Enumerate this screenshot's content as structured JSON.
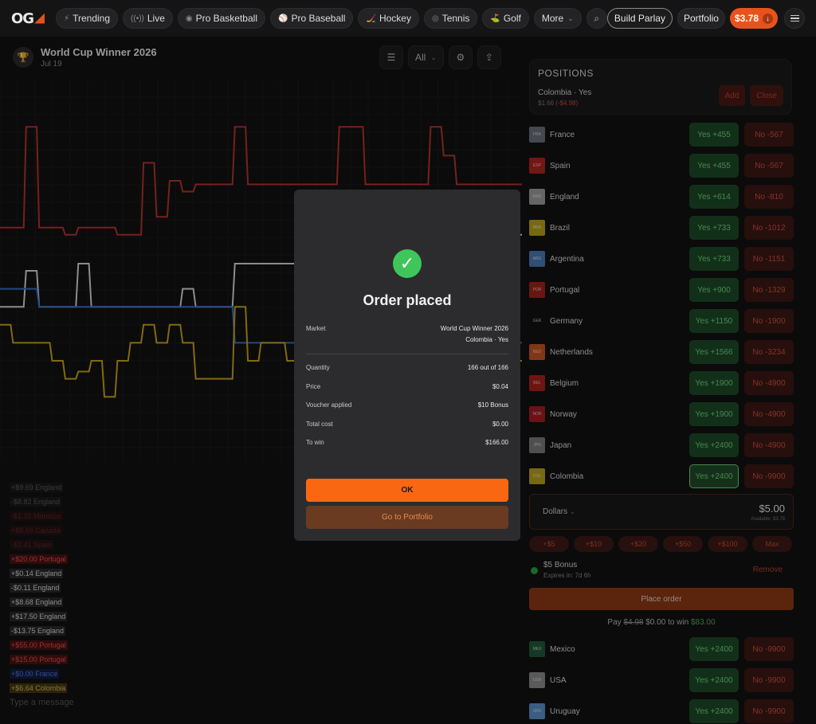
{
  "nav": {
    "logo_text": "OG",
    "tabs": [
      {
        "icon": "⚡",
        "label": "Trending"
      },
      {
        "icon": "((•))",
        "label": "Live"
      },
      {
        "icon": "◉",
        "label": "Pro Basketball"
      },
      {
        "icon": "⚾",
        "label": "Pro Baseball"
      },
      {
        "icon": "🏒",
        "label": "Hockey"
      },
      {
        "icon": "◎",
        "label": "Tennis"
      },
      {
        "icon": "⛳",
        "label": "Golf"
      },
      {
        "icon": "",
        "label": "More"
      }
    ],
    "build_parlay": "Build Parlay",
    "portfolio": "Portfolio",
    "balance": "$3.78"
  },
  "market": {
    "title": "World Cup Winner 2026",
    "date": "Jul 19",
    "filter_all": "All"
  },
  "chat": {
    "messages": [
      {
        "text": "+$9.69 England",
        "style": "dim"
      },
      {
        "text": "-$8.82 England",
        "style": "dim"
      },
      {
        "text": "-$1.32 Morocco",
        "style": "dim red"
      },
      {
        "text": "+$8.66 Canada",
        "style": "dim red"
      },
      {
        "text": "-$2.41 Spain",
        "style": "dim red"
      },
      {
        "text": "+$20.00 Portugal",
        "style": "red"
      },
      {
        "text": "+$0.14 England",
        "style": ""
      },
      {
        "text": "-$0.11 England",
        "style": ""
      },
      {
        "text": "+$8.68 England",
        "style": ""
      },
      {
        "text": "+$17.50 England",
        "style": ""
      },
      {
        "text": "-$13.75 England",
        "style": ""
      },
      {
        "text": "+$55.00 Portugal",
        "style": "red"
      },
      {
        "text": "+$15.00 Portugal",
        "style": "red"
      },
      {
        "text": "+$0.00 France",
        "style": "blue"
      },
      {
        "text": "+$6.64 Colombia",
        "style": "gold"
      }
    ],
    "placeholder": "Type a message"
  },
  "positions": {
    "title": "POSITIONS",
    "name": "Colombia · Yes",
    "value": "$1.66",
    "change": "(-$4.98)",
    "add": "Add",
    "close": "Close"
  },
  "teams": [
    {
      "code": "FRA",
      "name": "France",
      "yes": "Yes +455",
      "no": "No -567",
      "flag": "#6a6f7a"
    },
    {
      "code": "ESP",
      "name": "Spain",
      "yes": "Yes +455",
      "no": "No -567",
      "flag": "#b1241f"
    },
    {
      "code": "ENG",
      "name": "England",
      "yes": "Yes +614",
      "no": "No -810",
      "flag": "#9b9b9b"
    },
    {
      "code": "BRA",
      "name": "Brazil",
      "yes": "Yes +733",
      "no": "No -1012",
      "flag": "#b7a21c"
    },
    {
      "code": "ARG",
      "name": "Argentina",
      "yes": "Yes +733",
      "no": "No -1151",
      "flag": "#4b78b6"
    },
    {
      "code": "POR",
      "name": "Portugal",
      "yes": "Yes +900",
      "no": "No -1329",
      "flag": "#a0231c"
    },
    {
      "code": "GER",
      "name": "Germany",
      "yes": "Yes +1150",
      "no": "No -1900",
      "flag": "#121212"
    },
    {
      "code": "NED",
      "name": "Netherlands",
      "yes": "Yes +1566",
      "no": "No -3234",
      "flag": "#c55522"
    },
    {
      "code": "BEL",
      "name": "Belgium",
      "yes": "Yes +1900",
      "no": "No -4900",
      "flag": "#a8211c"
    },
    {
      "code": "NOR",
      "name": "Norway",
      "yes": "Yes +1900",
      "no": "No -4900",
      "flag": "#a01e26"
    },
    {
      "code": "JPN",
      "name": "Japan",
      "yes": "Yes +2400",
      "no": "No -4900",
      "flag": "#7a7a7a"
    },
    {
      "code": "COL",
      "name": "Colombia",
      "yes": "Yes +2400",
      "no": "No -9900",
      "flag": "#b9a020",
      "selected": true
    }
  ],
  "teams_bottom": [
    {
      "code": "MEX",
      "name": "Mexico",
      "yes": "Yes +2400",
      "no": "No -9900",
      "flag": "#1f5a3a"
    },
    {
      "code": "USA",
      "name": "USA",
      "yes": "Yes +2400",
      "no": "No -9900",
      "flag": "#8a8a8a"
    },
    {
      "code": "URU",
      "name": "Uruguay",
      "yes": "Yes +2400",
      "no": "No -9900",
      "flag": "#5b8fc7"
    }
  ],
  "order": {
    "unit": "Dollars",
    "amount": "$5.00",
    "available": "Available: $3.78",
    "quick": [
      "+$5",
      "+$10",
      "+$20",
      "+$50",
      "+$100",
      "Max"
    ],
    "bonus_title": "$5 Bonus",
    "bonus_expires": "Expires in: 7d 6h",
    "remove": "Remove",
    "place": "Place order",
    "pay_label": "Pay",
    "pay_old": "$4.98",
    "pay_new": "$0.00",
    "to_win_label": "to win",
    "to_win": "$83.00"
  },
  "modal": {
    "title": "Order placed",
    "market_label": "Market",
    "market_value": "World Cup Winner 2026",
    "market_sub": "Colombia · Yes",
    "rows": [
      {
        "label": "Quantity",
        "value": "166 out of 166"
      },
      {
        "label": "Price",
        "value": "$0.04"
      },
      {
        "label": "Voucher applied",
        "value": "$10 Bonus"
      },
      {
        "label": "Total cost",
        "value": "$0.00"
      },
      {
        "label": "To win",
        "value": "$166.00"
      }
    ],
    "ok": "OK",
    "portfolio": "Go to Portfolio"
  },
  "chart_data": {
    "type": "line",
    "title": "",
    "xlabel": "",
    "ylabel": "",
    "grid": true,
    "legend": "none",
    "x": [
      0,
      1,
      2,
      3,
      4,
      5,
      6,
      7,
      8,
      9,
      10,
      11,
      12,
      13,
      14,
      15,
      16,
      17,
      18,
      19,
      20,
      21,
      22,
      23,
      24,
      25,
      26,
      27,
      28,
      29,
      30,
      31,
      32,
      33,
      34,
      35,
      36,
      37,
      38,
      39,
      40
    ],
    "ylim": [
      0,
      100
    ],
    "series": [
      {
        "color": "#b73232",
        "values": [
          62,
          62,
          90,
          62,
          62,
          60,
          62,
          62,
          62,
          60,
          60,
          80,
          65,
          75,
          72,
          74,
          74,
          74,
          90,
          74,
          74,
          74,
          74,
          74,
          74,
          74,
          90,
          90,
          74,
          74,
          74,
          74,
          74,
          90,
          82,
          74,
          74,
          74,
          74,
          74,
          74
        ]
      },
      {
        "color": "#d8d8d8",
        "values": [
          40,
          40,
          50,
          40,
          40,
          40,
          52,
          40,
          40,
          40,
          40,
          40,
          40,
          40,
          45,
          40,
          40,
          40,
          52,
          52,
          52,
          52,
          52,
          52,
          52,
          52,
          52,
          52,
          52,
          52,
          58,
          58,
          58,
          58,
          58,
          58,
          60,
          60,
          60,
          60,
          60
        ]
      },
      {
        "color": "#3570c4",
        "values": [
          45,
          45,
          45,
          40,
          40,
          40,
          40,
          40,
          40,
          40,
          40,
          40,
          40,
          40,
          40,
          40,
          40,
          40,
          30,
          30,
          30,
          30,
          30,
          30,
          30,
          30,
          30,
          30,
          30,
          60,
          30,
          30,
          30,
          30,
          30,
          30,
          30,
          30,
          30,
          30,
          30
        ]
      },
      {
        "color": "#c9a21c",
        "values": [
          35,
          30,
          30,
          30,
          25,
          20,
          22,
          25,
          15,
          25,
          30,
          35,
          30,
          35,
          30,
          20,
          20,
          20,
          40,
          25,
          30,
          30,
          25,
          30,
          20,
          20,
          20,
          20,
          20,
          50,
          20,
          20,
          20,
          20,
          25,
          25,
          25,
          25,
          25,
          25,
          25
        ]
      }
    ]
  }
}
